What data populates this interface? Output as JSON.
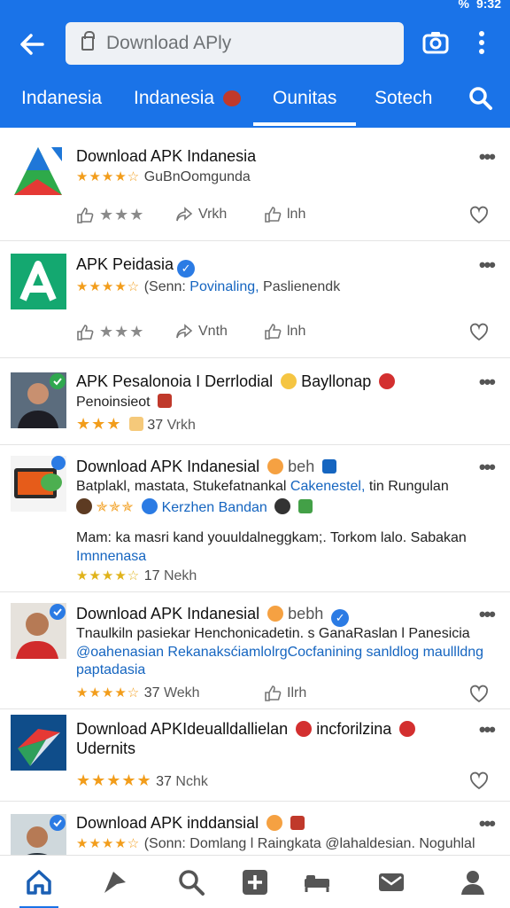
{
  "status": {
    "time": "9:32",
    "battery": "%"
  },
  "search": {
    "placeholder": "Download APly"
  },
  "tabs": [
    {
      "label": "Indanesia"
    },
    {
      "label": "Indanesia"
    },
    {
      "label": "Ounitas"
    },
    {
      "label": "Sotech"
    }
  ],
  "posts": [
    {
      "title": "Download APK Indanesia",
      "stars": "★★★★☆",
      "subtitle": "GuBnOomgunda",
      "like_stars": "★★★",
      "share_label": "Vrkh",
      "like_label": "lnh"
    },
    {
      "title": "APK Peidasia",
      "stars": "★★★★☆",
      "subtitle_prefix": "(Senn:",
      "subtitle_link": "Povinaling,",
      "subtitle_rest": "Paslienendk",
      "like_stars": "★★★",
      "share_label": "Vnth",
      "like_label": "lnh"
    },
    {
      "title": "APK Pesalonoia I Derrlodial",
      "title_suffix": "Bayllonap",
      "line2": "Penoinsieot",
      "stars": "★★★",
      "count": "37",
      "share_label": "Vrkh"
    },
    {
      "title": "Download APK Indanesial",
      "title_suffix": "beh",
      "line2_a": "Batplakl, mastata, Stukefatnankal",
      "line2_b": "Cakenestel,",
      "line2_c": "tin Rungulan",
      "line3": "Kerzhen Bandan",
      "line4": "Mam: ka masri kand youuldalneggkam;. Torkom lalo. Sabakan",
      "line5": "Imnnenasa",
      "stars": "★★★★☆",
      "count": "17",
      "share_label": "Nekh"
    },
    {
      "title": "Download APK Indanesial",
      "title_suffix": "bebh",
      "line2": "Tnaulkiln pasiekar Henchonicadetin. s GanaRaslan l Panesicia",
      "line3": "@oahenasian RekanaksćiamlolrgCocfanining sanldlog maullldng",
      "line4": "paptadasia",
      "stars": "★★★★☆",
      "count": "37",
      "share_label": "Wekh",
      "like_label": "Ilrh"
    },
    {
      "title": "Download APKIdeualldallielan",
      "title_suffix": "incforilzina",
      "line2": "Udernits",
      "stars": "★★★★★",
      "count": "37",
      "share_label": "Nchk"
    },
    {
      "title": "Download APK inddansial",
      "stars": "★★★★☆",
      "subtitle": "(Sonn: Domlang l Raingkata @lahaldesian. Noguhlal"
    }
  ],
  "colors": {
    "primary": "#1a73e8",
    "star": "#f29d1b",
    "link": "#1565c0"
  },
  "icons": [
    "back-arrow-icon",
    "lock-icon",
    "camera-icon",
    "more-vert-icon",
    "search-icon",
    "home-icon",
    "share-icon",
    "add-icon",
    "bed-icon",
    "mail-icon",
    "profile-icon"
  ]
}
